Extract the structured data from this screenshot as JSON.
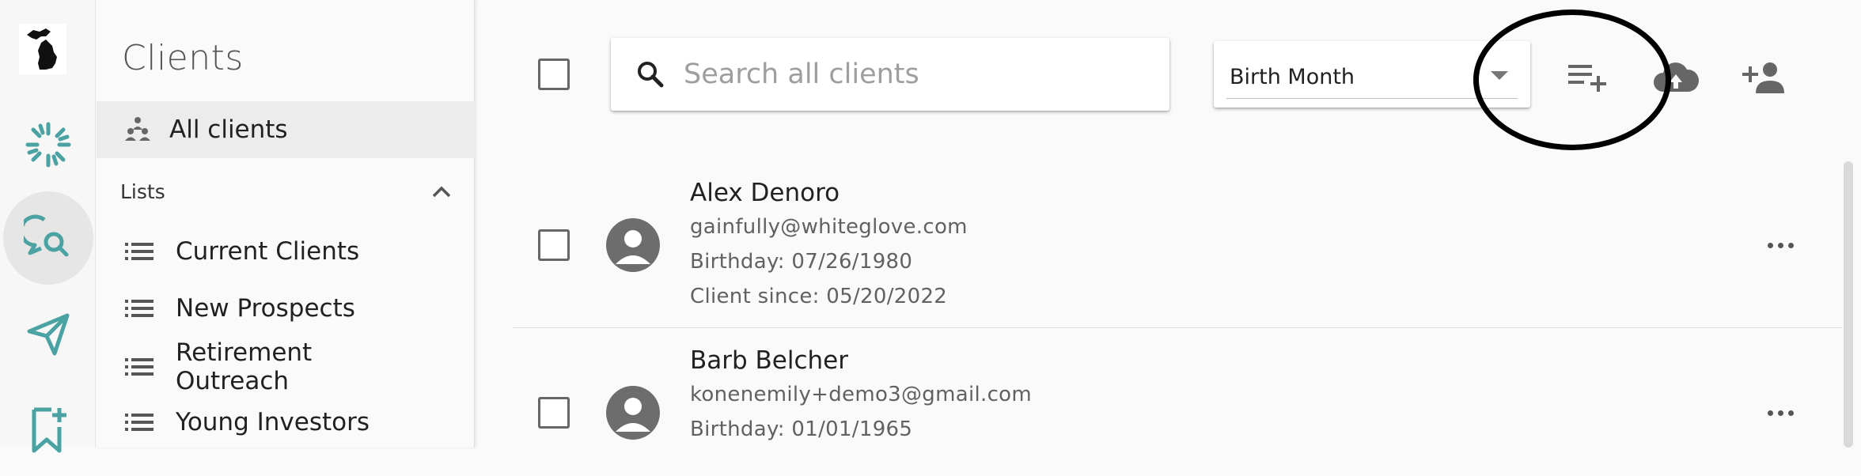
{
  "rail": {
    "items": [
      {
        "icon": "michigan-logo-icon"
      },
      {
        "icon": "spark-icon",
        "color": "#4aa3a2"
      },
      {
        "icon": "chat-search-icon",
        "color": "#4aa3a2",
        "active": true
      },
      {
        "icon": "send-icon",
        "color": "#4aa3a2"
      },
      {
        "icon": "bookmark-plus-icon",
        "color": "#4aa3a2"
      }
    ]
  },
  "sidebar": {
    "title": "Clients",
    "all_clients": {
      "label": "All clients",
      "icon": "people-icon"
    },
    "lists_header": {
      "label": "Lists",
      "icon": "chevron-up-icon"
    },
    "lists": [
      {
        "label": "Current Clients",
        "icon": "list-icon"
      },
      {
        "label": "New Prospects",
        "icon": "list-icon"
      },
      {
        "label": "Retirement\nOutreach",
        "icon": "list-icon"
      },
      {
        "label": "Young Investors",
        "icon": "list-icon"
      }
    ]
  },
  "toolbar": {
    "search": {
      "placeholder": "Search all clients",
      "value": "",
      "icon": "search-icon"
    },
    "sort": {
      "value": "Birth Month",
      "icon": "caret-down-icon"
    },
    "buttons": [
      {
        "name": "add-to-list-button",
        "icon": "playlist-add-icon"
      },
      {
        "name": "upload-button",
        "icon": "cloud-upload-icon"
      },
      {
        "name": "add-client-button",
        "icon": "person-add-icon"
      }
    ]
  },
  "clients": [
    {
      "name": "Alex Denoro",
      "email": "gainfully@whiteglove.com",
      "birthday": "Birthday: 07/26/1980",
      "client_since": "Client since: 05/20/2022"
    },
    {
      "name": "Barb Belcher",
      "email": "konenemily+demo3@gmail.com",
      "birthday": "Birthday: 01/01/1965"
    }
  ],
  "colors": {
    "accent": "#4aa3a2",
    "icon_gray": "#666666",
    "annotation": "#000000"
  }
}
